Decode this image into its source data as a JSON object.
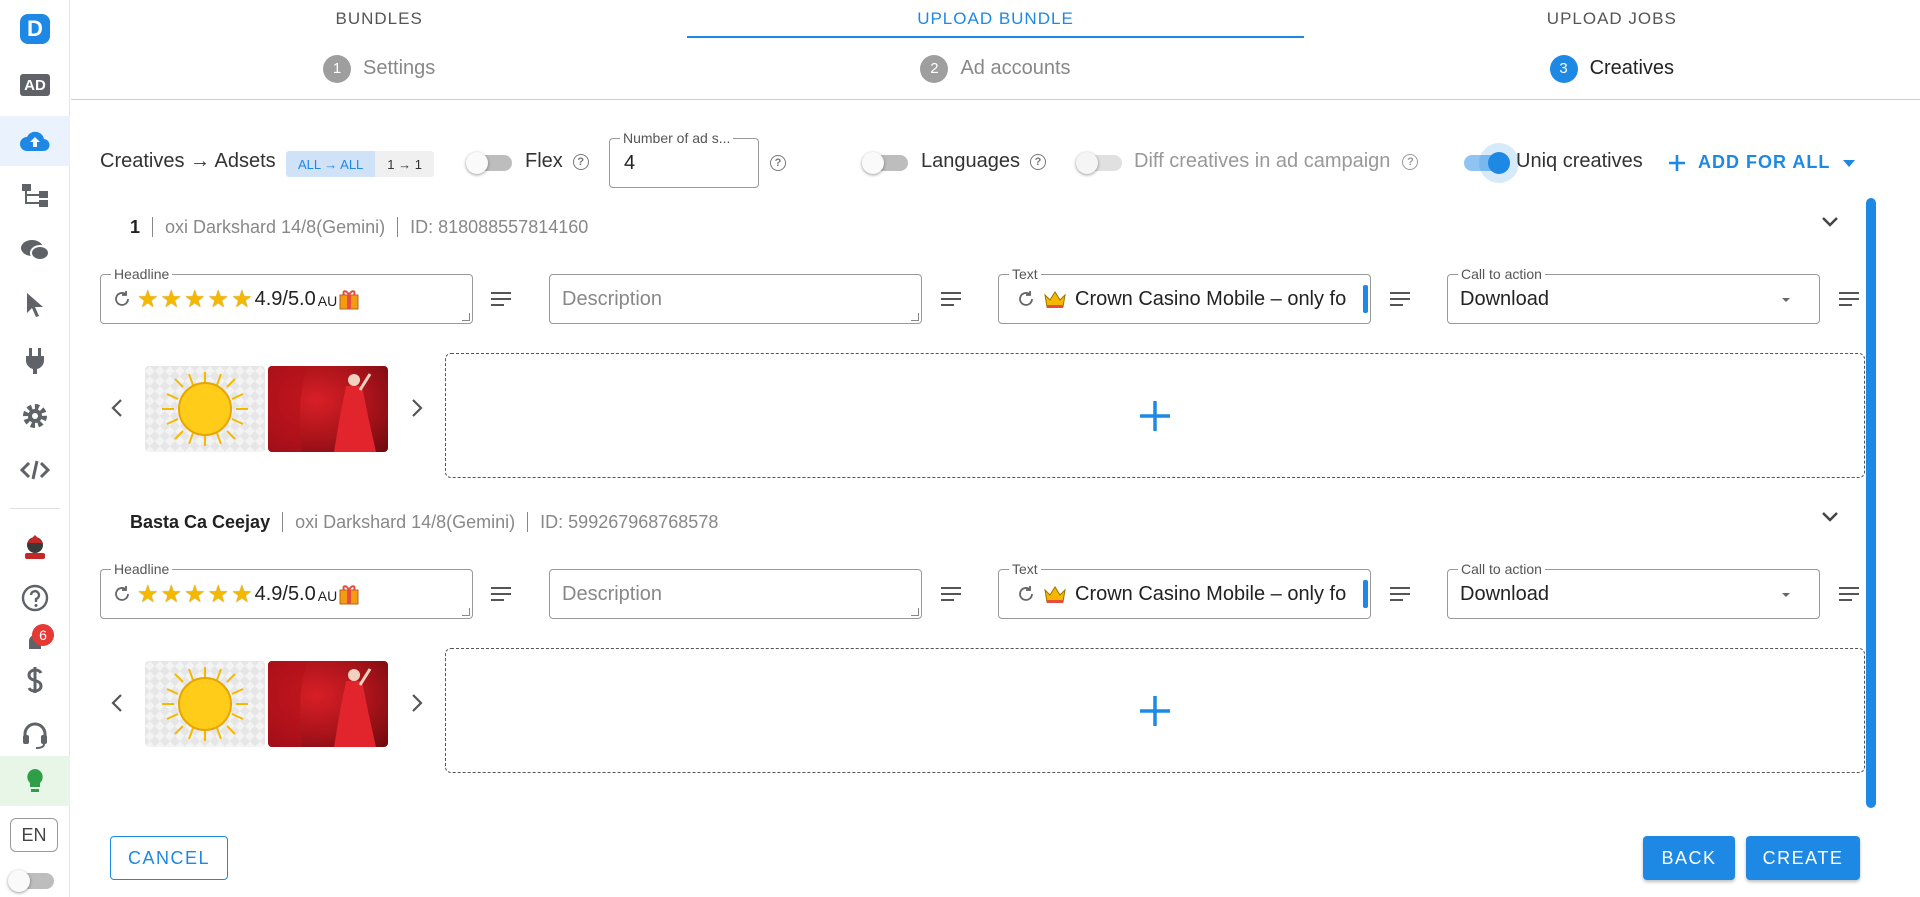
{
  "sidebar": {
    "logo_letter": "D",
    "ad_label": "AD",
    "notifications_count": "6",
    "language": "EN"
  },
  "tabs": [
    {
      "label": "BUNDLES"
    },
    {
      "label": "UPLOAD BUNDLE"
    },
    {
      "label": "UPLOAD JOBS"
    }
  ],
  "steps": [
    {
      "num": "1",
      "label": "Settings"
    },
    {
      "num": "2",
      "label": "Ad accounts"
    },
    {
      "num": "3",
      "label": "Creatives"
    }
  ],
  "options": {
    "mapping_label": "Creatives → Adsets",
    "mode_all": "ALL → ALL",
    "mode_one": "1 → 1",
    "flex_label": "Flex",
    "num_adsets_legend": "Number of ad s...",
    "num_adsets_value": "4",
    "languages_label": "Languages",
    "diff_creatives_label": "Diff creatives in ad campaign",
    "uniq_creatives_label": "Uniq creatives",
    "add_for_all_label": "ADD FOR ALL"
  },
  "creatives": [
    {
      "name": "1",
      "account": "oxi Darkshard 14/8(Gemini)",
      "id": "ID: 818088557814160",
      "headline_legend": "Headline",
      "headline_value": "4.9/5.0",
      "headline_suffix": "AU",
      "description_placeholder": "Description",
      "text_legend": "Text",
      "text_value": "Crown Casino Mobile – only fo",
      "cta_legend": "Call to action",
      "cta_value": "Download"
    },
    {
      "name": "Basta Ca Ceejay",
      "account": "oxi Darkshard 14/8(Gemini)",
      "id": "ID: 599267968768578",
      "headline_legend": "Headline",
      "headline_value": "4.9/5.0",
      "headline_suffix": "AU",
      "description_placeholder": "Description",
      "text_legend": "Text",
      "text_value": "Crown Casino Mobile – only fo",
      "cta_legend": "Call to action",
      "cta_value": "Download"
    }
  ],
  "footer": {
    "cancel_label": "CANCEL",
    "back_label": "BACK",
    "create_label": "CREATE"
  },
  "colors": {
    "accent": "#1e88e5",
    "danger": "#e53935",
    "sidebar_active": "#eaf3fd"
  }
}
